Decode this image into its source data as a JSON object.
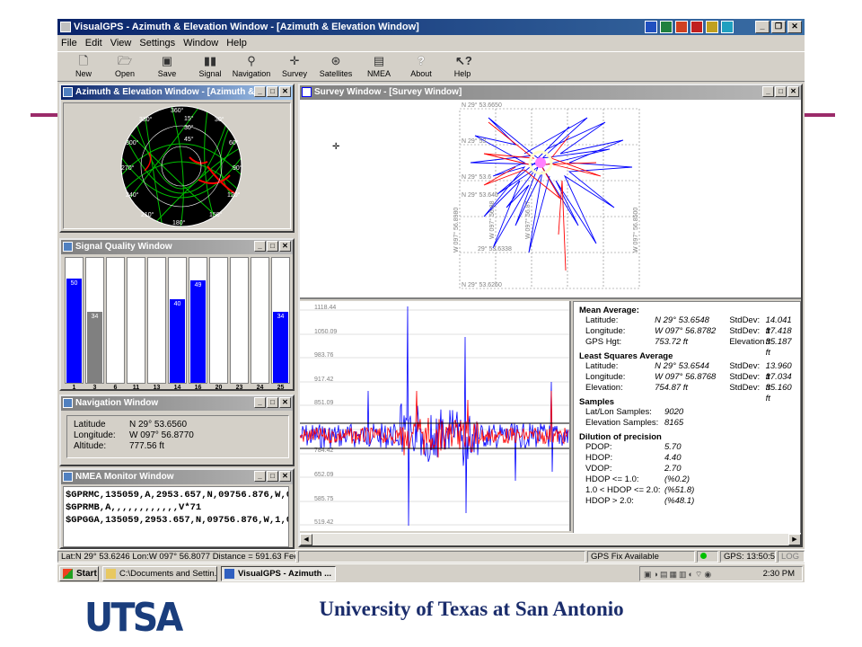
{
  "app": {
    "title": "VisualGPS - Azimuth & Elevation Window - [Azimuth & Elevation Window]"
  },
  "menu": [
    "File",
    "Edit",
    "View",
    "Settings",
    "Window",
    "Help"
  ],
  "toolbar": [
    {
      "label": "New",
      "icon": "new-file-icon"
    },
    {
      "label": "Open",
      "icon": "folder-open-icon"
    },
    {
      "label": "Save",
      "icon": "floppy-disk-icon"
    },
    {
      "label": "Signal",
      "icon": "signal-bars-icon"
    },
    {
      "label": "Navigation",
      "icon": "compass-icon"
    },
    {
      "label": "Survey",
      "icon": "crosshair-icon"
    },
    {
      "label": "Satellites",
      "icon": "satellite-icon"
    },
    {
      "label": "NMEA",
      "icon": "nmea-terminal-icon"
    },
    {
      "label": "About",
      "icon": "question-icon"
    },
    {
      "label": "Help",
      "icon": "help-arrow-icon"
    }
  ],
  "azel": {
    "title": "Azimuth & Elevation Window - [Azimuth &...",
    "labels": {
      "n": "360°",
      "ring15": "15°",
      "ring30": "30°",
      "ring45": "45°",
      "az330": "330°",
      "az300": "300°",
      "az270": "270°",
      "az240": "240°",
      "az210": "210°",
      "az180": "180°",
      "az150": "150°",
      "az120": "120°",
      "az90": "90°",
      "az60": "60°",
      "az30": "30°"
    }
  },
  "signal": {
    "title": "Signal Quality Window",
    "bars": [
      {
        "prn": "1",
        "value": 50,
        "color": "#0000ff"
      },
      {
        "prn": "3",
        "value": 34,
        "color": "#808080"
      },
      {
        "prn": "6",
        "value": 0,
        "color": "#0000ff"
      },
      {
        "prn": "11",
        "value": 0,
        "color": "#0000ff"
      },
      {
        "prn": "13",
        "value": 0,
        "color": "#0000ff"
      },
      {
        "prn": "14",
        "value": 40,
        "color": "#0000ff"
      },
      {
        "prn": "16",
        "value": 49,
        "color": "#0000ff"
      },
      {
        "prn": "20",
        "value": 0,
        "color": "#0000ff"
      },
      {
        "prn": "23",
        "value": 0,
        "color": "#0000ff"
      },
      {
        "prn": "24",
        "value": 0,
        "color": "#0000ff"
      },
      {
        "prn": "25",
        "value": 34,
        "color": "#0000ff"
      }
    ],
    "max": 60
  },
  "navigation": {
    "title": "Navigation Window",
    "lat_label": "Latitude",
    "lat_value": "N 29° 53.6560",
    "lon_label": "Longitude:",
    "lon_value": "W 097° 56.8770",
    "alt_label": "Altitude:",
    "alt_value": "777.56  ft"
  },
  "nmea": {
    "title": "NMEA Monitor Window",
    "lines": [
      "$GPRMC,135059,A,2953.657,N,09756.876,W,0",
      "$GPRMB,A,,,,,,,,,,,,V*71",
      "$GPGGA,135059,2953.657,N,09756.876,W,1,0"
    ]
  },
  "survey": {
    "title": "Survey Window - [Survey Window]",
    "lat_labels": [
      "N 29° 53.6650",
      "N 29° 53.",
      "N 29° 53.6",
      "N 29° 53.646",
      "29° 53.6338",
      "N 29° 53.6260"
    ],
    "lon_labels": [
      "W 097° 56.8980",
      "W 097° 56.88",
      "W 097° 56.87",
      "W 097° 56.8500"
    ]
  },
  "elevation_plot": {
    "y_labels": [
      "1118.44",
      "1050.09",
      "983.76",
      "917.42",
      "851.09",
      "784.42",
      "652.09",
      "585.75",
      "519.42"
    ]
  },
  "stats": {
    "mean_header": "Mean Average:",
    "mean": [
      {
        "k": "Latitude:",
        "v": "N 29° 53.6548",
        "k2": "StdDev:",
        "v2": "14.041 ft"
      },
      {
        "k": "Longitude:",
        "v": "W 097° 56.8782",
        "k2": "StdDev:",
        "v2": "17.418 ft"
      },
      {
        "k": "GPS Hgt:",
        "v": "753.72  ft",
        "k2": "Elevation",
        "v2": "35.187 ft"
      }
    ],
    "ls_header": "Least Squares Average",
    "ls": [
      {
        "k": "Latitude:",
        "v": "N 29° 53.6544",
        "k2": "StdDev:",
        "v2": "13.960 ft"
      },
      {
        "k": "Longitude:",
        "v": "W 097° 56.8768",
        "k2": "StdDev:",
        "v2": "17.034 ft"
      },
      {
        "k": "Elevation:",
        "v": "754.87  ft",
        "k2": "StdDev:",
        "v2": "35.160 ft"
      }
    ],
    "samples_header": "Samples",
    "samples": [
      {
        "k": "Lat/Lon Samples:",
        "v": "9020"
      },
      {
        "k": "Elevation Samples:",
        "v": "8165"
      }
    ],
    "dop_header": "Dilution of precision",
    "dop": [
      {
        "k": "PDOP:",
        "v": "5.70"
      },
      {
        "k": "HDOP:",
        "v": "4.40"
      },
      {
        "k": "VDOP:",
        "v": "2.70"
      },
      {
        "k": "HDOP <= 1.0:",
        "v": "(%0.2)"
      },
      {
        "k": "1.0 < HDOP <= 2.0:",
        "v": "(%51.8)"
      },
      {
        "k": "HDOP > 2.0:",
        "v": "(%48.1)"
      }
    ]
  },
  "statusbar": {
    "position": "Lat:N 29° 53.6246  Lon:W 097° 56.8077  Distance = 591.63   Feet",
    "fix": "GPS Fix Available",
    "gps_time": "GPS: 13:50:57",
    "gps_state": "LOG"
  },
  "taskbar": {
    "start": "Start",
    "tasks": [
      "C:\\Documents and Settin...",
      "VisualGPS - Azimuth ..."
    ],
    "clock": "2:30 PM"
  },
  "slide": {
    "logo": "UTSA",
    "footer": "University of Texas at San Antonio"
  },
  "colors": {
    "blue": "#0000ff",
    "red": "#ff0000",
    "green": "#00c000",
    "titlebar": "#0a246a",
    "accent_rule": "#9b2b6a"
  }
}
